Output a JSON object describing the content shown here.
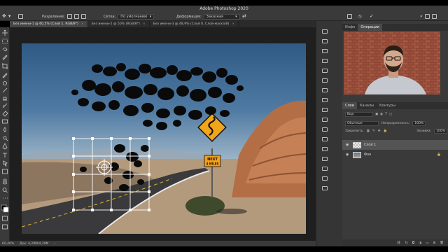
{
  "app": {
    "title": "Adobe Photoshop 2020"
  },
  "options_bar": {
    "mode_label": "Разделение:",
    "grid_label": "Сетка:",
    "grid_value": "По умолчанию",
    "warp_label": "Деформация:",
    "warp_value": "Заказная",
    "cancel_glyph": "⦸",
    "commit_glyph": "✓"
  },
  "doc_tabs": [
    {
      "label": "Без имени-1 @ 60,5% (Слой 1, RGB/8*)",
      "close": "×",
      "active": true
    },
    {
      "label": "Без имени-2 @ 50% (RGB/8*)",
      "close": "×",
      "active": false
    },
    {
      "label": "Без имени-3 @ 48,9% (Слой 0, Слой-маска/8)",
      "close": "×",
      "active": false
    }
  ],
  "sign": {
    "line1": "NEXT",
    "line2": "4 MILES"
  },
  "status_bar": {
    "zoom": "60,46%",
    "doc": "Док: 4,29M/4,29M",
    "arrow": "›"
  },
  "right_panel": {
    "top_tabs": [
      "Инфо",
      "Операции"
    ],
    "layers_tabs": [
      "Слои",
      "Каналы",
      "Контуры"
    ],
    "kind_label": "Вид",
    "blend_mode": "Обычные",
    "opacity_label": "Непрозрачность:",
    "opacity_value": "100%",
    "lock_label": "Закрепить:",
    "fill_label": "Заливка:",
    "fill_value": "100%",
    "layers": [
      {
        "name": "Слой 1",
        "selected": true,
        "locked": false
      },
      {
        "name": "Фон",
        "selected": false,
        "locked": true
      }
    ],
    "footer_icons": [
      "link-icon",
      "fx-icon",
      "mask-icon",
      "adjustment-icon",
      "folder-icon",
      "new-layer-icon",
      "trash-icon"
    ]
  },
  "colors": {
    "ui_dark": "#3a3a3a",
    "ui_panel": "#2b2b2b",
    "sign_yellow": "#f1a519",
    "sign_orange": "#f2a01a"
  }
}
